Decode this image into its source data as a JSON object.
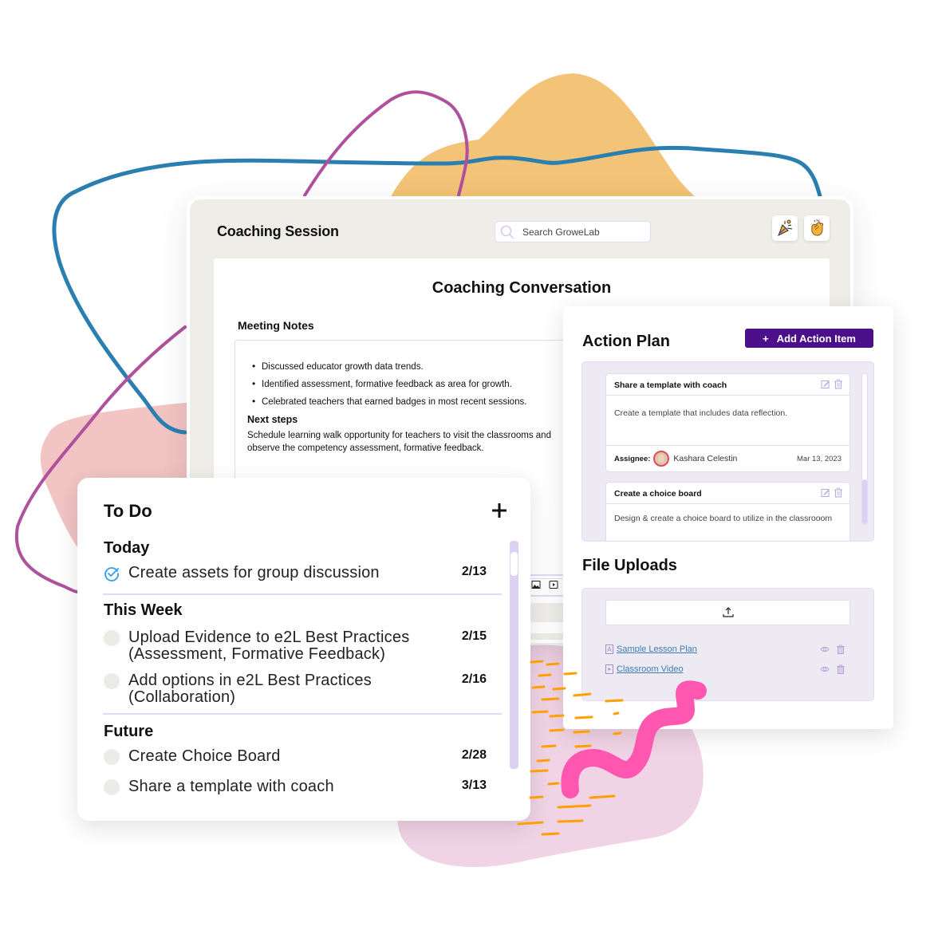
{
  "colors": {
    "accent_purple": "#4b0f8a",
    "border_lavender": "#e4d9f6",
    "panel_gray": "#eeede8",
    "link_blue": "#3f7cb2",
    "check_blue": "#2ea1ea",
    "blob_orange": "#f3c477",
    "blob_pink": "#f2c4c4",
    "blob_lilac": "#f1d3e6",
    "line_blue": "#2b7fb0",
    "line_purple": "#b0519d",
    "squiggle_pink": "#ff57b0",
    "dash_orange": "#ffa000"
  },
  "session": {
    "title": "Coaching Session",
    "search_placeholder": "Search GroweLab",
    "icons": [
      "party-popper-icon",
      "clapping-hands-icon"
    ],
    "conversation_title": "Coaching Conversation",
    "meeting_notes_label": "Meeting Notes",
    "notes": [
      "Discussed educator growth data trends.",
      "Identified assessment, formative feedback as area for growth.",
      "Celebrated teachers that earned badges in most recent sessions."
    ],
    "next_steps_label": "Next steps",
    "next_steps_text": "Schedule learning walk opportunity for teachers to visit the classrooms and observe the competency assessment, formative feedback."
  },
  "action_plan": {
    "title": "Action Plan",
    "add_button_icon": "+",
    "add_button_label": "Add Action Item",
    "items": [
      {
        "title": "Share a template with coach",
        "description": "Create a template that includes data reflection.",
        "assignee_label": "Assignee:",
        "assignee_name": "Kashara Celestin",
        "due_date": "Mar 13, 2023"
      },
      {
        "title": "Create a choice board",
        "description": "Design & create a choice board to utilize in the classrooom"
      }
    ]
  },
  "file_uploads": {
    "title": "File Uploads",
    "files": [
      {
        "name": "Sample Lesson Plan",
        "type": "pdf"
      },
      {
        "name": "Classroom Video",
        "type": "video"
      }
    ]
  },
  "todo": {
    "title": "To Do",
    "sections": [
      {
        "label": "Today",
        "items": [
          {
            "text": "Create assets for group discussion",
            "date": "2/13",
            "done": true
          }
        ]
      },
      {
        "label": "This Week",
        "items": [
          {
            "text": "Upload Evidence to e2L Best Practices (Assessment, Formative Feedback)",
            "date": "2/15",
            "done": false
          },
          {
            "text": "Add options in e2L Best Practices (Collaboration)",
            "date": "2/16",
            "done": false
          }
        ]
      },
      {
        "label": "Future",
        "items": [
          {
            "text": "Create Choice Board",
            "date": "2/28",
            "done": false
          },
          {
            "text": "Share a template with coach",
            "date": "3/13",
            "done": false
          }
        ]
      }
    ]
  }
}
